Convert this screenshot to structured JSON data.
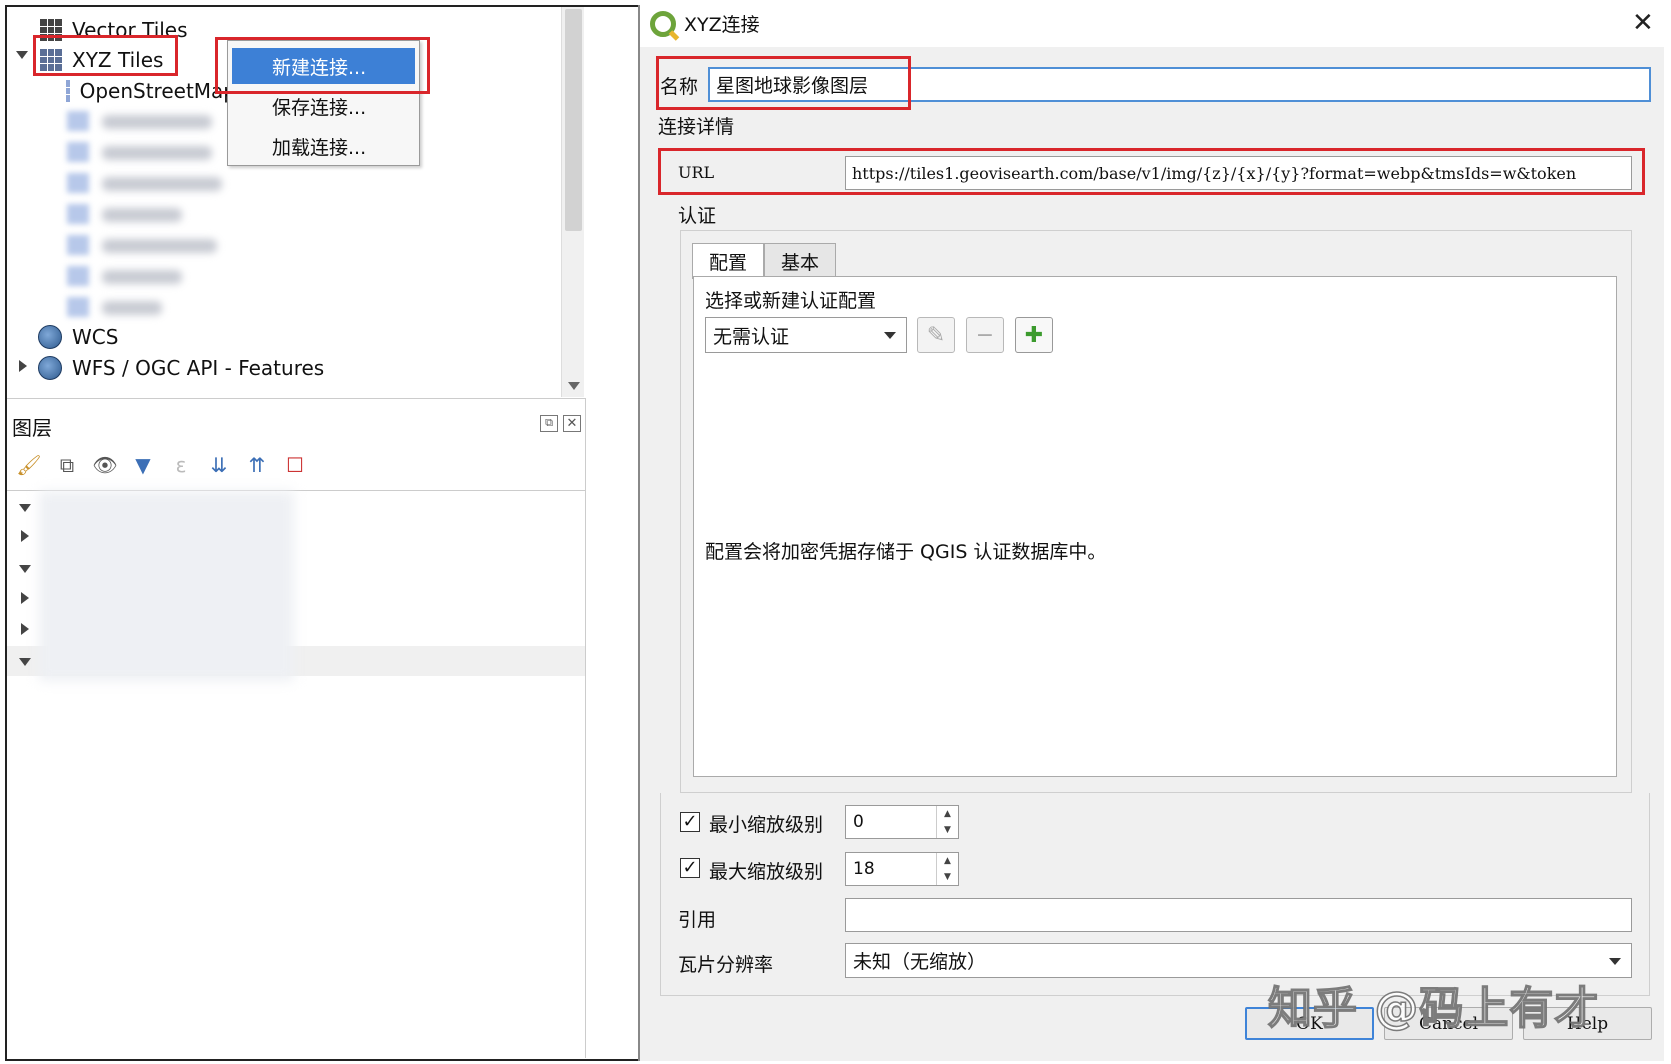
{
  "browser": {
    "items": [
      {
        "label": "Vector Tiles"
      },
      {
        "label": "XYZ Tiles"
      },
      {
        "label": "OpenStreetMap"
      },
      {
        "label": "WCS"
      },
      {
        "label": "WFS / OGC API - Features"
      }
    ]
  },
  "context_menu": {
    "items": [
      "新建连接...",
      "保存连接...",
      "加载连接..."
    ]
  },
  "layers_panel": {
    "title": "图层"
  },
  "dialog": {
    "title": "XYZ连接",
    "name_label": "名称",
    "name_value": "星图地球影像图层",
    "connection_details_label": "连接详情",
    "url_label": "URL",
    "url_value": "https://tiles1.geovisearth.com/base/v1/img/{z}/{x}/{y}?format=webp&tmsIds=w&token",
    "auth_label": "认证",
    "tabs": [
      "配置",
      "基本"
    ],
    "auth_select_label": "选择或新建认证配置",
    "auth_combo_value": "无需认证",
    "auth_note": "配置会将加密凭据存储于 QGIS 认证数据库中。",
    "min_zoom_label": "最小缩放级别",
    "min_zoom_value": "0",
    "min_zoom_checked": true,
    "max_zoom_label": "最大缩放级别",
    "max_zoom_value": "18",
    "max_zoom_checked": true,
    "referer_label": "引用",
    "referer_value": "",
    "tile_resolution_label": "瓦片分辨率",
    "tile_resolution_value": "未知（无缩放）",
    "buttons": {
      "ok": "OK",
      "cancel": "Cancel",
      "help": "Help"
    }
  },
  "watermark": "知乎 @码上有才",
  "colors": {
    "highlight_red": "#d9262b",
    "menu_selected": "#3d80d6"
  }
}
